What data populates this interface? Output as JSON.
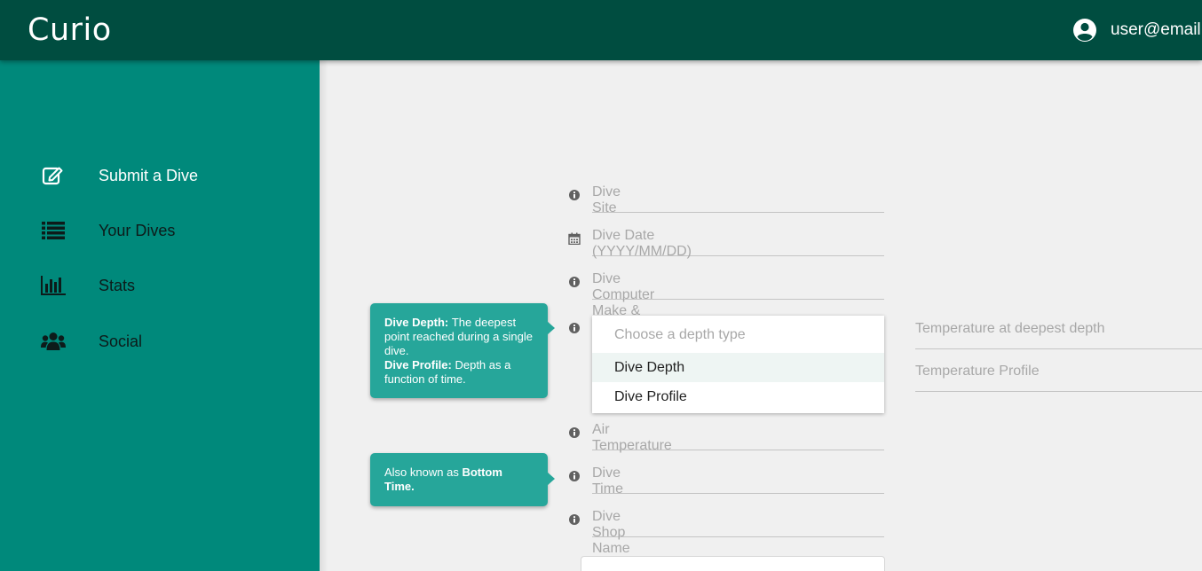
{
  "header": {
    "app_title": "Curio",
    "user_email": "user@email",
    "user_icon": "account-circle-icon",
    "bg_color": "#004d40"
  },
  "sidebar": {
    "bg_color": "#00897b",
    "items": [
      {
        "label": "Submit a Dive",
        "icon": "edit-icon",
        "active": true
      },
      {
        "label": "Your Dives",
        "icon": "list-icon",
        "active": false
      },
      {
        "label": "Stats",
        "icon": "bar-chart-icon",
        "active": false
      },
      {
        "label": "Social",
        "icon": "users-icon",
        "active": false
      }
    ]
  },
  "form": {
    "dive_site": {
      "placeholder": "Dive Site",
      "icon": "info-icon"
    },
    "dive_date": {
      "placeholder": "Dive Date (YYYY/MM/DD)",
      "icon": "calendar-icon"
    },
    "dive_computer": {
      "placeholder": "Dive Computer Make & Model",
      "icon": "info-icon"
    },
    "depth_type": {
      "placeholder": "Choose a depth type",
      "icon": "info-icon",
      "options": [
        "Dive Depth",
        "Dive Profile"
      ]
    },
    "air_temperature": {
      "placeholder": "Air Temperature",
      "icon": "info-icon"
    },
    "dive_time": {
      "placeholder": "Dive Time",
      "icon": "info-icon"
    },
    "dive_shop": {
      "placeholder": "Dive Shop Name",
      "icon": "info-icon"
    },
    "temp_deepest": {
      "placeholder": "Temperature at deepest depth"
    },
    "temp_profile": {
      "placeholder": "Temperature Profile"
    }
  },
  "tooltips": {
    "depth": {
      "term1": "Dive Depth:",
      "desc1": "The deepest point reached during a single dive.",
      "term2": "Dive Profile:",
      "desc2": "Depth as a function of time."
    },
    "time": {
      "prefix": "Also known as",
      "term": "Bottom Time."
    }
  }
}
